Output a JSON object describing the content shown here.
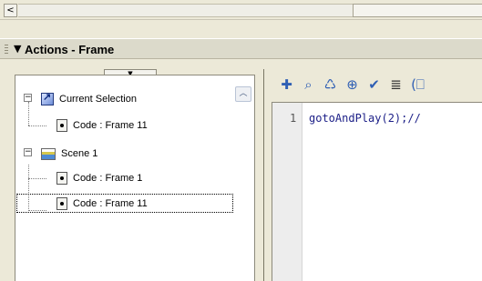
{
  "panel": {
    "title": "Actions - Frame"
  },
  "tree": {
    "items": [
      {
        "label": "Current Selection",
        "icon": "selection-icon"
      },
      {
        "label": "Code : Frame 11",
        "icon": "code-icon"
      },
      {
        "label": "Scene 1",
        "icon": "scene-icon"
      },
      {
        "label": "Code : Frame 1",
        "icon": "code-icon"
      },
      {
        "label": "Code : Frame 11",
        "icon": "code-icon"
      }
    ]
  },
  "toolbar": {
    "tools": [
      "add-icon",
      "find-icon",
      "replace-icon",
      "target-icon",
      "check-syntax-icon",
      "auto-format-icon",
      "code-hint-icon"
    ]
  },
  "editor": {
    "line_number": "1",
    "code": "gotoAndPlay(2);//"
  },
  "colors": {
    "panel_bg": "#ece9d8",
    "header_bg": "#dcdacb",
    "code_text": "#1d2088"
  }
}
